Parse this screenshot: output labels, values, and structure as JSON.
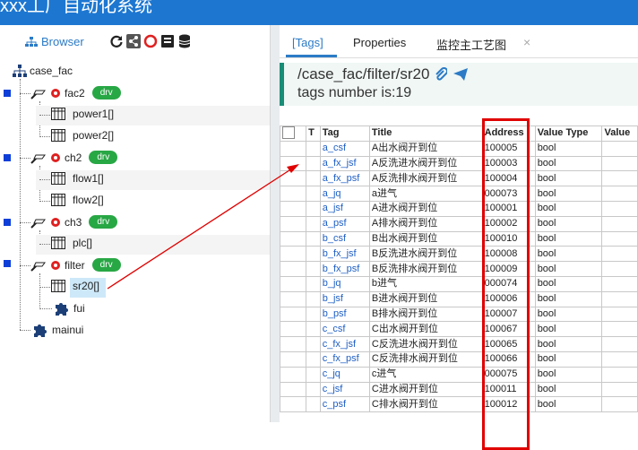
{
  "app": {
    "title": "xxx工厂自动化系统"
  },
  "left_panel": {
    "browser_tab": "Browser",
    "toolbar_icons": [
      "refresh-icon",
      "share-icon",
      "power-icon",
      "book-icon",
      "database-icon"
    ],
    "tree": {
      "root": "case_fac",
      "fac2": {
        "label": "fac2",
        "badge": "drv",
        "children": [
          "power1[]",
          "power2[]"
        ]
      },
      "ch2": {
        "label": "ch2",
        "badge": "drv",
        "children": [
          "flow1[]",
          "flow2[]"
        ]
      },
      "ch3": {
        "label": "ch3",
        "badge": "drv",
        "children": [
          "plc[]"
        ]
      },
      "filter": {
        "label": "filter",
        "badge": "drv",
        "children": [
          "sr20[]",
          "fui"
        ]
      },
      "mainui": "mainui"
    }
  },
  "right_panel": {
    "tabs": [
      {
        "label": "[Tags]",
        "active": true
      },
      {
        "label": "Properties",
        "active": false
      },
      {
        "label": "监控主工艺图",
        "active": false
      }
    ],
    "close_symbol": "×",
    "path": "/case_fac/filter/sr20",
    "tags_count_text": "tags number is:19",
    "table": {
      "columns": [
        "T",
        "Tag",
        "Title",
        "Address",
        "Value Type",
        "Value"
      ],
      "rows": [
        {
          "tag": "a_csf",
          "title": "A出水阀开到位",
          "address": "100005",
          "type": "bool"
        },
        {
          "tag": "a_fx_jsf",
          "title": "A反洗进水阀开到位",
          "address": "100003",
          "type": "bool"
        },
        {
          "tag": "a_fx_psf",
          "title": "A反洗排水阀开到位",
          "address": "100004",
          "type": "bool"
        },
        {
          "tag": "a_jq",
          "title": "a进气",
          "address": "000073",
          "type": "bool"
        },
        {
          "tag": "a_jsf",
          "title": "A进水阀开到位",
          "address": "100001",
          "type": "bool"
        },
        {
          "tag": "a_psf",
          "title": "A排水阀开到位",
          "address": "100002",
          "type": "bool"
        },
        {
          "tag": "b_csf",
          "title": "B出水阀开到位",
          "address": "100010",
          "type": "bool"
        },
        {
          "tag": "b_fx_jsf",
          "title": "B反洗进水阀开到位",
          "address": "100008",
          "type": "bool"
        },
        {
          "tag": "b_fx_psf",
          "title": "B反洗排水阀开到位",
          "address": "100009",
          "type": "bool"
        },
        {
          "tag": "b_jq",
          "title": "b进气",
          "address": "000074",
          "type": "bool"
        },
        {
          "tag": "b_jsf",
          "title": "B进水阀开到位",
          "address": "100006",
          "type": "bool"
        },
        {
          "tag": "b_psf",
          "title": "B排水阀开到位",
          "address": "100007",
          "type": "bool"
        },
        {
          "tag": "c_csf",
          "title": "C出水阀开到位",
          "address": "100067",
          "type": "bool"
        },
        {
          "tag": "c_fx_jsf",
          "title": "C反洗进水阀开到位",
          "address": "100065",
          "type": "bool"
        },
        {
          "tag": "c_fx_psf",
          "title": "C反洗排水阀开到位",
          "address": "100066",
          "type": "bool"
        },
        {
          "tag": "c_jq",
          "title": "c进气",
          "address": "000075",
          "type": "bool"
        },
        {
          "tag": "c_jsf",
          "title": "C进水阀开到位",
          "address": "100011",
          "type": "bool"
        },
        {
          "tag": "c_psf",
          "title": "C排水阀开到位",
          "address": "100012",
          "type": "bool"
        }
      ]
    }
  },
  "colors": {
    "topbar": "#1d77d1",
    "accent": "#2c7bc6",
    "badge": "#28a745",
    "highlight": "#e00000",
    "info_border": "#1a8d77"
  }
}
